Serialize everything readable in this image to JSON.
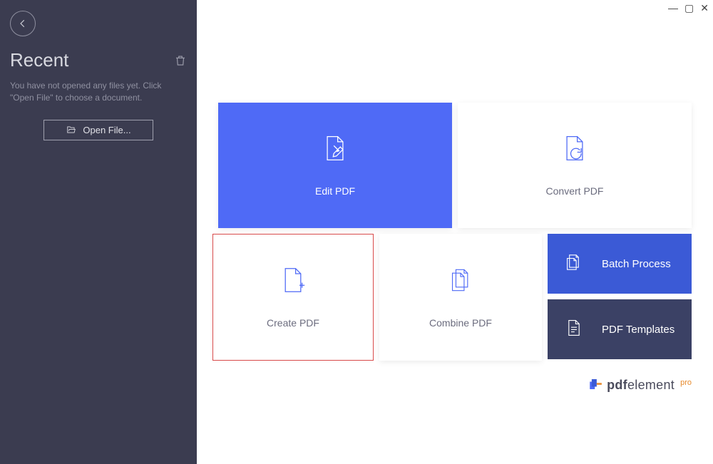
{
  "sidebar": {
    "title": "Recent",
    "message": "You have not opened any files yet. Click \"Open File\" to choose a document.",
    "open_label": "Open File..."
  },
  "tiles": {
    "edit": "Edit PDF",
    "convert": "Convert PDF",
    "create": "Create PDF",
    "combine": "Combine PDF",
    "batch": "Batch Process",
    "templates": "PDF Templates"
  },
  "brand": {
    "name_prefix": "pdf",
    "name_suffix": "element",
    "tier": "pro"
  },
  "window": {
    "min": "—",
    "max": "▢",
    "close": "✕"
  }
}
